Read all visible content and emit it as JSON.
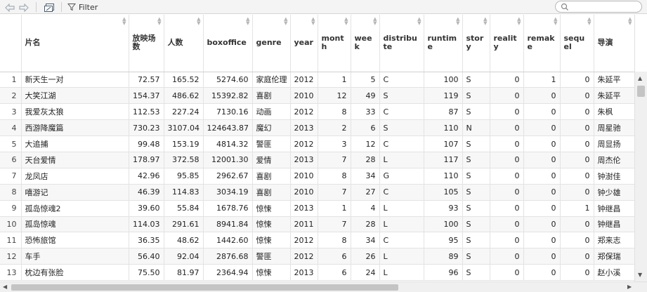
{
  "toolbar": {
    "filter_label": "Filter",
    "search_placeholder": ""
  },
  "columns": [
    "片名",
    "放映场数",
    "人数",
    "boxoffice",
    "genre",
    "year",
    "month",
    "week",
    "distribute",
    "runtime",
    "story",
    "reality",
    "remake",
    "sequel",
    "导演"
  ],
  "rows": [
    [
      "1",
      "新天生一对",
      "72.57",
      "165.52",
      "5274.60",
      "家庭伦理",
      "2012",
      "1",
      "5",
      "C",
      "100",
      "S",
      "0",
      "1",
      "0",
      "朱延平"
    ],
    [
      "2",
      "大笑江湖",
      "154.37",
      "486.62",
      "15392.82",
      "喜剧",
      "2010",
      "12",
      "49",
      "S",
      "119",
      "S",
      "0",
      "0",
      "0",
      "朱延平"
    ],
    [
      "3",
      "我爱灰太狼",
      "112.53",
      "227.24",
      "7130.16",
      "动画",
      "2012",
      "8",
      "33",
      "C",
      "87",
      "S",
      "0",
      "0",
      "0",
      "朱枫"
    ],
    [
      "4",
      "西游降魔篇",
      "730.23",
      "3107.04",
      "124643.87",
      "魔幻",
      "2013",
      "2",
      "6",
      "S",
      "110",
      "N",
      "0",
      "0",
      "0",
      "周星驰"
    ],
    [
      "5",
      "大追捕",
      "99.48",
      "153.19",
      "4814.32",
      "警匪",
      "2012",
      "3",
      "12",
      "C",
      "107",
      "S",
      "0",
      "0",
      "0",
      "周显扬"
    ],
    [
      "6",
      "天台爱情",
      "178.97",
      "372.58",
      "12001.30",
      "爱情",
      "2013",
      "7",
      "28",
      "L",
      "117",
      "S",
      "0",
      "0",
      "0",
      "周杰伦"
    ],
    [
      "7",
      "龙凤店",
      "42.96",
      "95.85",
      "2962.67",
      "喜剧",
      "2010",
      "8",
      "34",
      "G",
      "110",
      "S",
      "0",
      "0",
      "0",
      "钟澍佳"
    ],
    [
      "8",
      "嘻游记",
      "46.39",
      "114.83",
      "3034.19",
      "喜剧",
      "2010",
      "7",
      "27",
      "C",
      "105",
      "S",
      "0",
      "0",
      "0",
      "钟少雄"
    ],
    [
      "9",
      "孤岛惊魂2",
      "39.60",
      "55.84",
      "1678.76",
      "惊悚",
      "2013",
      "1",
      "4",
      "L",
      "93",
      "S",
      "0",
      "0",
      "1",
      "钟继昌"
    ],
    [
      "10",
      "孤岛惊魂",
      "114.03",
      "291.61",
      "8941.84",
      "惊悚",
      "2011",
      "7",
      "28",
      "L",
      "100",
      "S",
      "0",
      "0",
      "0",
      "钟继昌"
    ],
    [
      "11",
      "恐怖旅馆",
      "36.35",
      "48.62",
      "1442.60",
      "惊悚",
      "2012",
      "8",
      "34",
      "C",
      "95",
      "S",
      "0",
      "0",
      "0",
      "郑来志"
    ],
    [
      "12",
      "车手",
      "56.40",
      "92.04",
      "2876.68",
      "警匪",
      "2012",
      "6",
      "26",
      "L",
      "89",
      "S",
      "0",
      "0",
      "0",
      "郑保瑞"
    ],
    [
      "13",
      "枕边有张脸",
      "75.50",
      "81.97",
      "2364.94",
      "惊悚",
      "2013",
      "6",
      "24",
      "L",
      "96",
      "S",
      "0",
      "0",
      "0",
      "赵小溪"
    ]
  ]
}
